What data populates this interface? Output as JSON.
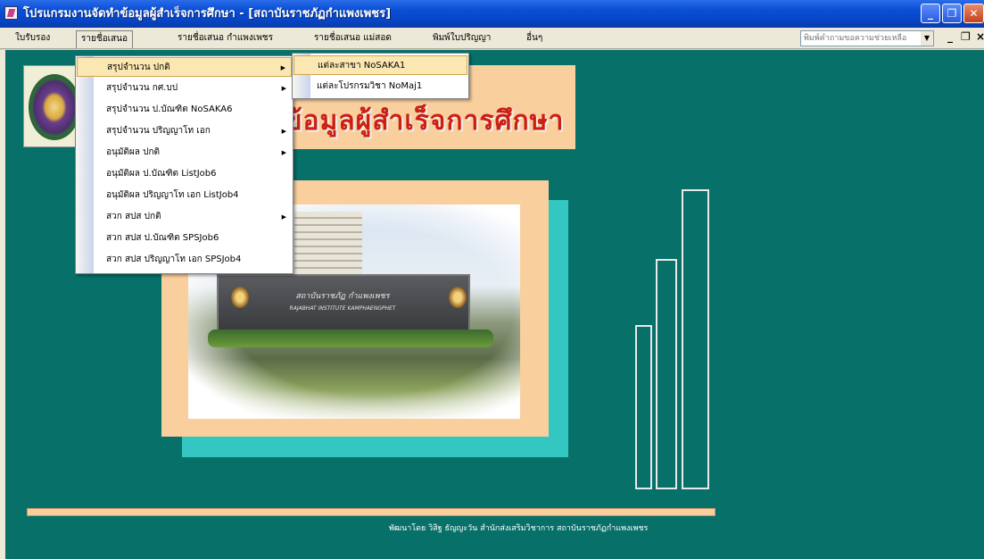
{
  "window": {
    "title": "โปรแกรมงานจัดทำข้อมูลผู้สำเร็จการศึกษา - [สถาบันราชภัฏกำแพงเพชร]",
    "minimize_glyph": "_",
    "restore_glyph": "❐",
    "close_glyph": "✕"
  },
  "menubar": {
    "items": [
      "ใบรับรอง",
      "รายชื่อเสนอ",
      "รายชื่อเสนอ กำแพงเพชร",
      "รายชื่อเสนอ แม่สอด",
      "พิมพ์ใบปริญญา",
      "อื่นๆ"
    ],
    "open_index": 1,
    "help_placeholder": "พิมพ์คำถามขอความช่วยเหลือ",
    "mdi_controls": [
      "_",
      "❐",
      "×"
    ]
  },
  "dropdown": {
    "items": [
      {
        "label": "สรุปจำนวน ปกติ",
        "has_submenu": true,
        "highlighted": true
      },
      {
        "label": "สรุปจำนวน กศ.บป",
        "has_submenu": true
      },
      {
        "label": "สรุปจำนวน ป.บัณฑิต NoSAKA6",
        "has_submenu": false
      },
      {
        "label": "สรุปจำนวน ปริญญาโท เอก",
        "has_submenu": true
      },
      {
        "label": "อนุมัติผล ปกติ",
        "has_submenu": true
      },
      {
        "label": "อนุมัติผล ป.บัณฑิต ListJob6",
        "has_submenu": false
      },
      {
        "label": "อนุมัติผล ปริญญาโท เอก ListJob4",
        "has_submenu": false
      },
      {
        "label": "สวก สปส ปกติ",
        "has_submenu": true
      },
      {
        "label": "สวก สปส ป.บัณฑิต SPSJob6",
        "has_submenu": false
      },
      {
        "label": "สวก สปส ปริญญาโท เอก SPSJob4",
        "has_submenu": false
      }
    ]
  },
  "submenu": {
    "items": [
      "แต่ละสาขา NoSAKA1",
      "แต่ละโปรกรมวิชา NoMaj1"
    ]
  },
  "main": {
    "headline": "ข้อมูลผู้สำเร็จการศึกษา",
    "sign_text": "สถาบันราชภัฏ กำแพงเพชร",
    "sign_subtext": "RAJABHAT INSTITUTE KAMPHAENGPHET",
    "footer": "พัฒนาโดย วิสิฐ ธัญญะวัน สำนักส่งเสริมวิชาการ สถาบันราชภัฏกำแพงเพชร"
  },
  "colors": {
    "background": "#077068",
    "peach": "#f9cf9e",
    "cyan": "#34c6c0",
    "headline": "#cc1f12",
    "highlight": "#fbe7b2"
  }
}
